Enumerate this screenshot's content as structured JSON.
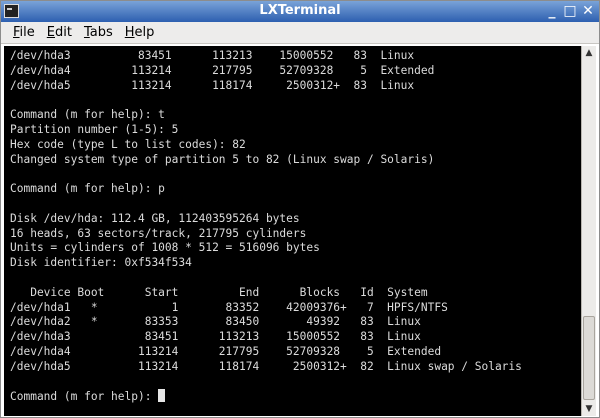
{
  "window": {
    "title": "LXTerminal",
    "controls": {
      "minimize": "_",
      "maximize": "□",
      "close": "✕"
    }
  },
  "menu": [
    {
      "underline": "F",
      "rest": "ile"
    },
    {
      "underline": "E",
      "rest": "dit"
    },
    {
      "underline": "T",
      "rest": "abs"
    },
    {
      "underline": "H",
      "rest": "elp"
    }
  ],
  "terminal": {
    "lines": [
      "/dev/hda3          83451      113213    15000552   83  Linux",
      "/dev/hda4         113214      217795    52709328    5  Extended",
      "/dev/hda5         113214      118174     2500312+  83  Linux",
      "",
      "Command (m for help): t",
      "Partition number (1-5): 5",
      "Hex code (type L to list codes): 82",
      "Changed system type of partition 5 to 82 (Linux swap / Solaris)",
      "",
      "Command (m for help): p",
      "",
      "Disk /dev/hda: 112.4 GB, 112403595264 bytes",
      "16 heads, 63 sectors/track, 217795 cylinders",
      "Units = cylinders of 1008 * 512 = 516096 bytes",
      "Disk identifier: 0xf534f534",
      "",
      "   Device Boot      Start         End      Blocks   Id  System",
      "/dev/hda1   *           1       83352    42009376+   7  HPFS/NTFS",
      "/dev/hda2   *       83353       83450       49392   83  Linux",
      "/dev/hda3           83451      113213    15000552   83  Linux",
      "/dev/hda4          113214      217795    52709328    5  Extended",
      "/dev/hda5          113214      118174     2500312+  82  Linux swap / Solaris",
      "",
      "Command (m for help): "
    ]
  }
}
